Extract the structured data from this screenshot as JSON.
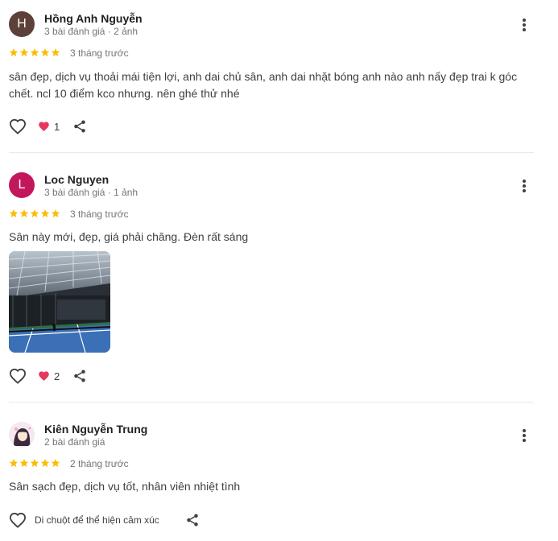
{
  "reviews": [
    {
      "avatar_letter": "H",
      "avatar_color": "#5d4037",
      "name": "Hồng Anh Nguyễn",
      "meta": "3 bài đánh giá · 2 ảnh",
      "rating": 5,
      "date": "3 tháng trước",
      "text": "sân đẹp, dịch vụ thoải mái tiện lợi, anh dai chủ sân, anh dai nhặt bóng anh nào anh nấy đẹp trai k góc chết. ncl 10 điểm kco nhưng. nên ghé thử nhé",
      "reaction_count": "1"
    },
    {
      "avatar_letter": "L",
      "avatar_color": "#c2185b",
      "name": "Loc Nguyen",
      "meta": "3 bài đánh giá · 1 ảnh",
      "rating": 5,
      "date": "3 tháng trước",
      "text": "Sân này mới, đẹp, giá phải chăng. Đèn rất sáng",
      "reaction_count": "2"
    },
    {
      "name": "Kiên Nguyễn Trung",
      "meta": "2 bài đánh giá",
      "rating": 5,
      "date": "2 tháng trước",
      "text": "Sân sạch đẹp, dịch vụ tốt, nhân viên nhiệt tình",
      "hover_hint": "Di chuột để thể hiện cảm xúc"
    }
  ],
  "icons": {
    "star": "star-icon",
    "like": "heart-outline-icon",
    "reaction": "heart-filled-icon",
    "share": "share-icon",
    "more": "more-vertical-icon"
  },
  "colors": {
    "star": "#fbbc04",
    "reaction": "#e8365d"
  }
}
